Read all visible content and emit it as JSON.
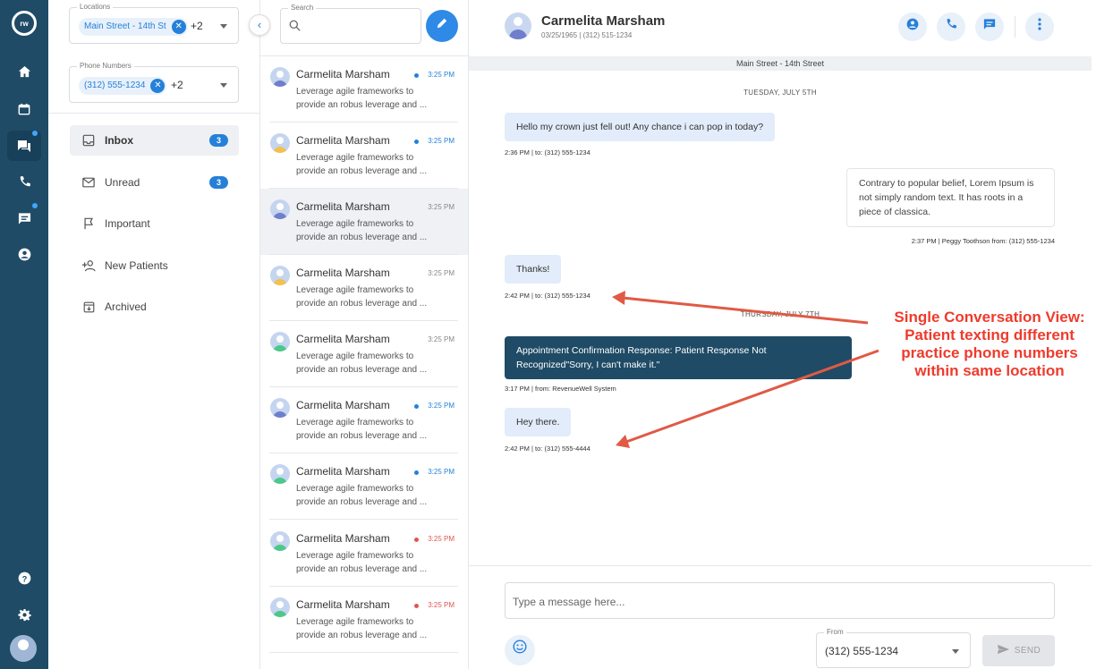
{
  "filters": {
    "locations_label": "Locations",
    "location_chip": "Main Street - 14th St",
    "location_more": "+2",
    "phones_label": "Phone Numbers",
    "phone_chip": "(312) 555-1234",
    "phone_more": "+2",
    "folders": [
      {
        "label": "Inbox",
        "count": "3",
        "icon": "inbox-icon"
      },
      {
        "label": "Unread",
        "count": "3",
        "icon": "mail-icon"
      },
      {
        "label": "Important",
        "count": "",
        "icon": "flag-icon"
      },
      {
        "label": "New Patients",
        "count": "",
        "icon": "add-user-icon"
      },
      {
        "label": "Archived",
        "count": "",
        "icon": "archive-icon"
      }
    ]
  },
  "search": {
    "label": "Search",
    "placeholder": ""
  },
  "conversations": [
    {
      "name": "Carmelita Marsham",
      "time": "3:25 PM",
      "preview": "Leverage agile frameworks to provide an robus leverage and ...",
      "status": "blue",
      "shirt": "#6f7fcb"
    },
    {
      "name": "Carmelita Marsham",
      "time": "3:25 PM",
      "preview": "Leverage agile frameworks to provide an robus leverage and ...",
      "status": "blue",
      "shirt": "#f2c14e"
    },
    {
      "name": "Carmelita Marsham",
      "time": "3:25 PM",
      "preview": "Leverage agile frameworks to provide an robus leverage and ...",
      "status": "none",
      "shirt": "#6f7fcb"
    },
    {
      "name": "Carmelita Marsham",
      "time": "3:25 PM",
      "preview": "Leverage agile frameworks to provide an robus leverage and ...",
      "status": "none",
      "shirt": "#f2c14e"
    },
    {
      "name": "Carmelita Marsham",
      "time": "3:25 PM",
      "preview": "Leverage agile frameworks to provide an robus leverage and ...",
      "status": "none",
      "shirt": "#4cc98a"
    },
    {
      "name": "Carmelita Marsham",
      "time": "3:25 PM",
      "preview": "Leverage agile frameworks to provide an robus leverage and ...",
      "status": "blue",
      "shirt": "#6f7fcb"
    },
    {
      "name": "Carmelita Marsham",
      "time": "3:25 PM",
      "preview": "Leverage agile frameworks to provide an robus leverage and ...",
      "status": "blue",
      "shirt": "#4cc98a"
    },
    {
      "name": "Carmelita Marsham",
      "time": "3:25 PM",
      "preview": "Leverage agile frameworks to provide an robus leverage and ...",
      "status": "red",
      "shirt": "#4cc98a"
    },
    {
      "name": "Carmelita Marsham",
      "time": "3:25 PM",
      "preview": "Leverage agile frameworks to provide an robus leverage and ...",
      "status": "red",
      "shirt": "#4cc98a"
    }
  ],
  "header": {
    "name": "Carmelita Marsham",
    "sub": "03/25/1965  |  (312) 515-1234"
  },
  "thread": {
    "location": "Main Street - 14th Street",
    "day1": "TUESDAY, JULY 5TH",
    "day2": "THURSDAY, JULY 7TH",
    "messages": [
      {
        "text": "Hello my crown just fell out! Any chance i can pop in today?",
        "meta": "2:36 PM  |  to: (312) 555-1234"
      },
      {
        "text": "Contrary to popular belief, Lorem Ipsum is not simply random text. It has roots in a piece of classica.",
        "meta": "2:37 PM  |  Peggy Toothson from:  (312) 555-1234"
      },
      {
        "text": "Thanks!",
        "meta": "2:42 PM  |  to: (312) 555-1234"
      },
      {
        "text": "Appointment Confirmation Response: Patient Response Not Recognized\"Sorry, I can't make it.\"",
        "meta": "3:17 PM  |  from: RevenueWell System"
      },
      {
        "text": "Hey there.",
        "meta": "2:42 PM  |  to:  (312) 555-4444"
      }
    ]
  },
  "composer": {
    "placeholder": "Type a message here...",
    "from_label": "From",
    "from_value": "(312) 555-1234",
    "send_label": "SEND"
  },
  "annotation": {
    "text": "Single Conversation View: Patient texting different practice phone numbers within same location"
  },
  "colors": {
    "rail": "#1f4b66",
    "accent": "#2680d9",
    "annotation": "#ee3b2c"
  }
}
